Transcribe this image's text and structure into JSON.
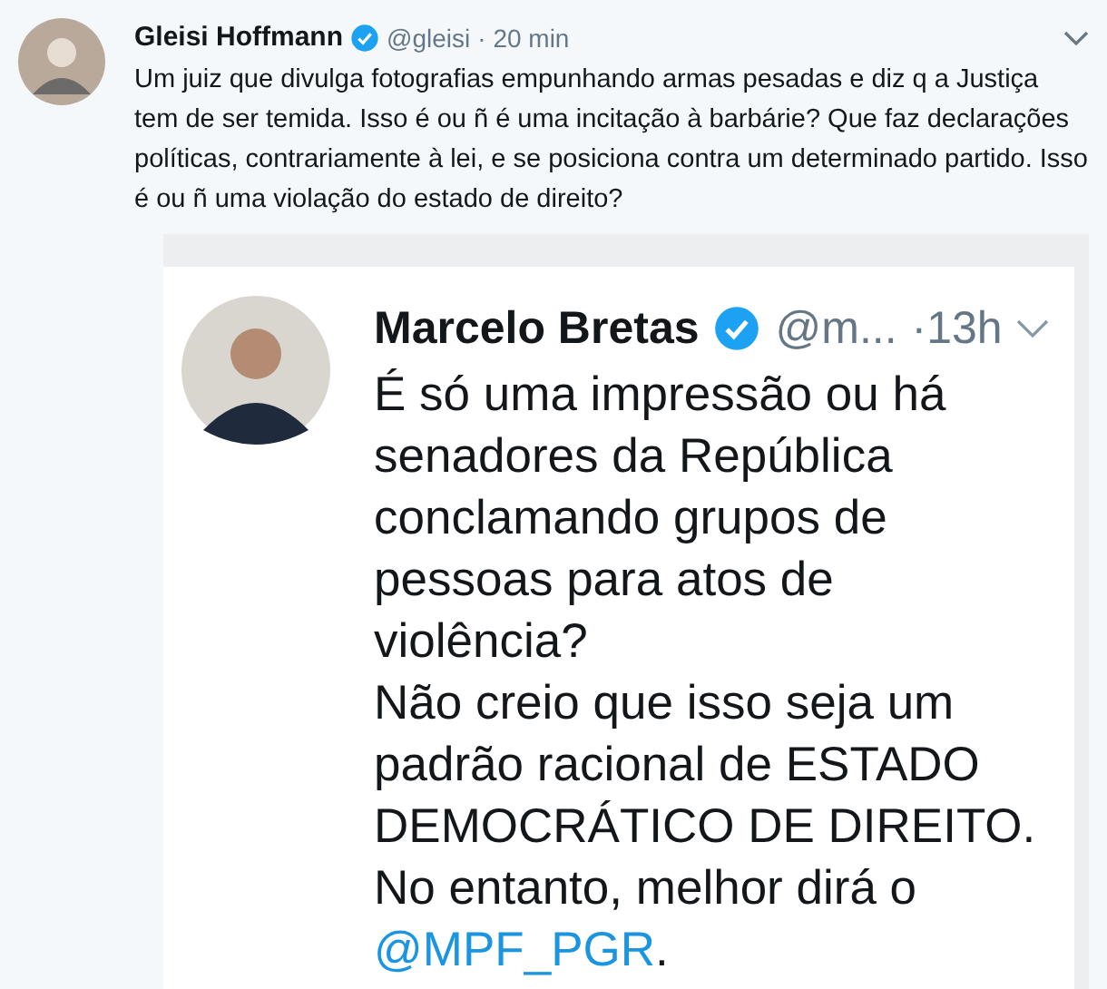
{
  "tweet": {
    "name": "Gleisi Hoffmann",
    "verified": true,
    "handle": "@gleisi",
    "time": "· 20 min",
    "text": "Um juiz que divulga fotografias empunhando armas pesadas e diz q a Justiça tem de ser temida. Isso é ou ñ é uma incitação à barbárie? Que faz declarações políticas, contrariamente à lei, e se posiciona contra um determinado partido. Isso é ou ñ uma violação do estado de direito?"
  },
  "quoted_image": {
    "name": "Marcelo Bretas",
    "verified": true,
    "handle": "@m...",
    "time": "·13h",
    "lines": [
      {
        "kind": "text",
        "text": "É só uma impressão ou há"
      },
      {
        "kind": "text",
        "text": "senadores da República"
      },
      {
        "kind": "text",
        "text": "conclamando grupos de"
      },
      {
        "kind": "text",
        "text": "pessoas para atos de"
      },
      {
        "kind": "text",
        "text": "violência?"
      },
      {
        "kind": "text",
        "text": "Não creio que isso seja um"
      },
      {
        "kind": "text",
        "text": "padrão racional de ESTADO"
      },
      {
        "kind": "text",
        "text": "DEMOCRÁTICO DE DIREITO."
      },
      {
        "kind": "text",
        "text": "No entanto, melhor dirá o"
      },
      {
        "kind": "link",
        "text": "@MPF_PGR",
        "tail": "."
      }
    ]
  }
}
